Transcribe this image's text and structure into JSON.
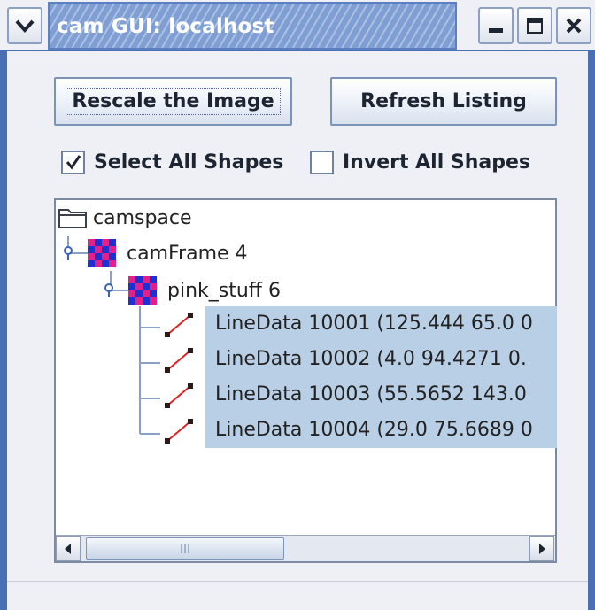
{
  "window": {
    "title": "cam GUI: localhost",
    "menu_icon": "chevron-down-icon",
    "minimize_icon": "minimize-icon",
    "maximize_icon": "maximize-icon",
    "close_icon": "close-icon"
  },
  "toolbar": {
    "rescale_label": "Rescale the Image",
    "refresh_label": "Refresh Listing"
  },
  "options": {
    "select_all_label": "Select All Shapes",
    "select_all_checked": true,
    "invert_all_label": "Invert All Shapes",
    "invert_all_checked": false
  },
  "tree": {
    "root": {
      "label": "camspace",
      "icon": "folder-icon"
    },
    "frame": {
      "label": "camFrame 4",
      "icon": "checker-icon"
    },
    "shape": {
      "label": "pink_stuff 6",
      "icon": "checker-icon"
    },
    "leaves": [
      {
        "label": "LineData 10001 (125.444 65.0 0",
        "icon": "line-icon"
      },
      {
        "label": "LineData 10002 (4.0 94.4271 0.",
        "icon": "line-icon"
      },
      {
        "label": "LineData 10003 (55.5652 143.0",
        "icon": "line-icon"
      },
      {
        "label": "LineData 10004 (29.0 75.6689 0",
        "icon": "line-icon"
      }
    ]
  },
  "colors": {
    "title_bar": "#7f9ed3",
    "selection": "#b8cfe6",
    "checker_a": "#e0208c",
    "checker_b": "#2030d0",
    "line_icon": "#e02020"
  }
}
